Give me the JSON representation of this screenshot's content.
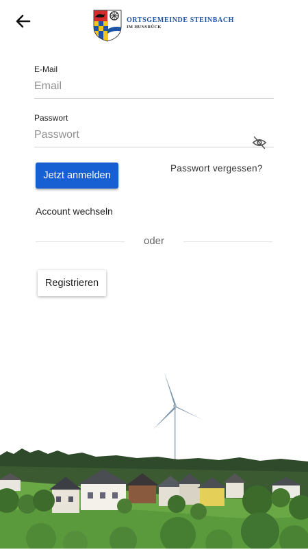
{
  "header": {
    "logo_title": "Ortsgemeinde Steinbach",
    "logo_subtitle": "im Hunsrück"
  },
  "form": {
    "email": {
      "label": "E-Mail",
      "placeholder": "Email",
      "value": ""
    },
    "password": {
      "label": "Passwort",
      "placeholder": "Passwort",
      "value": ""
    },
    "login_label": "Jetzt anmelden",
    "forgot_label": "Passwort vergessen?",
    "switch_account_label": "Account wechseln",
    "divider_label": "oder",
    "register_label": "Registrieren"
  },
  "colors": {
    "primary": "#1760d3",
    "logo_blue": "#1c53a6",
    "grass": "#5a9a3c"
  },
  "icons": {
    "back": "arrow-left",
    "password_toggle": "eye-off"
  }
}
